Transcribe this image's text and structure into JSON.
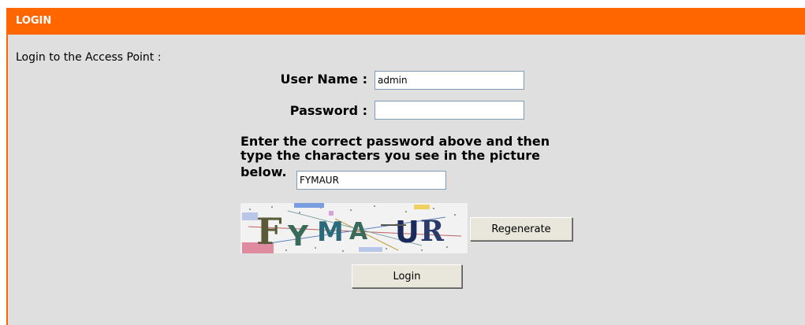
{
  "header": {
    "title": "LOGIN"
  },
  "intro": "Login to the Access Point :",
  "form": {
    "username_label": "User Name  :",
    "username_value": "admin",
    "password_label": "Password  :",
    "password_value": "",
    "instruction_line1": "Enter the correct password above and then",
    "instruction_line2": "type the characters you see in the picture",
    "instruction_line3": "below.",
    "captcha_value": "FYMAUR",
    "captcha_text": "FYMAUR"
  },
  "buttons": {
    "regenerate": "Regenerate",
    "login": "Login"
  },
  "colors": {
    "header": "#ff6600",
    "panel": "#dfdfdf"
  }
}
